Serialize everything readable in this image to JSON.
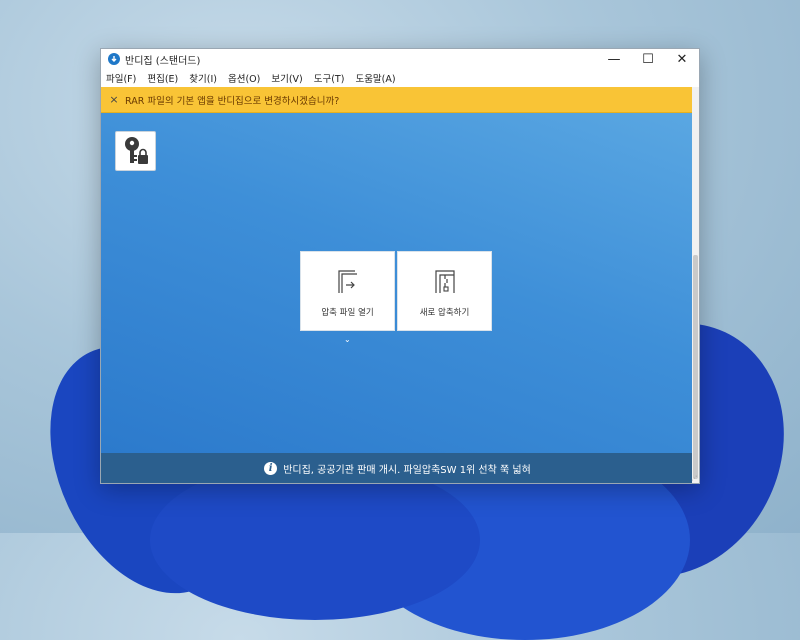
{
  "window": {
    "title": "반디집 (스탠더드)",
    "controls": {
      "minimize": "—",
      "maximize": "☐",
      "close": "✕"
    }
  },
  "menu": {
    "items": [
      "파일(F)",
      "편집(E)",
      "찾기(I)",
      "옵션(O)",
      "보기(V)",
      "도구(T)",
      "도움말(A)"
    ]
  },
  "notice": {
    "close_glyph": "×",
    "text": "RAR 파일의 기본 앱을 반디집으로 변경하시겠습니까?",
    "color": "#f9c436"
  },
  "main": {
    "key_icon": "key-lock-icon",
    "actions": [
      {
        "label": "압축 파일 열기",
        "icon": "open-archive-icon"
      },
      {
        "label": "새로 압축하기",
        "icon": "new-archive-icon"
      }
    ],
    "caret_glyph": "⌄",
    "background_color": "#3e8fd8"
  },
  "footer": {
    "info_glyph": "i",
    "text": "반디집, 공공기관 판매 개시. 파일압축SW 1위 선착 쭉 넓혀",
    "color": "#2b5f8e"
  }
}
